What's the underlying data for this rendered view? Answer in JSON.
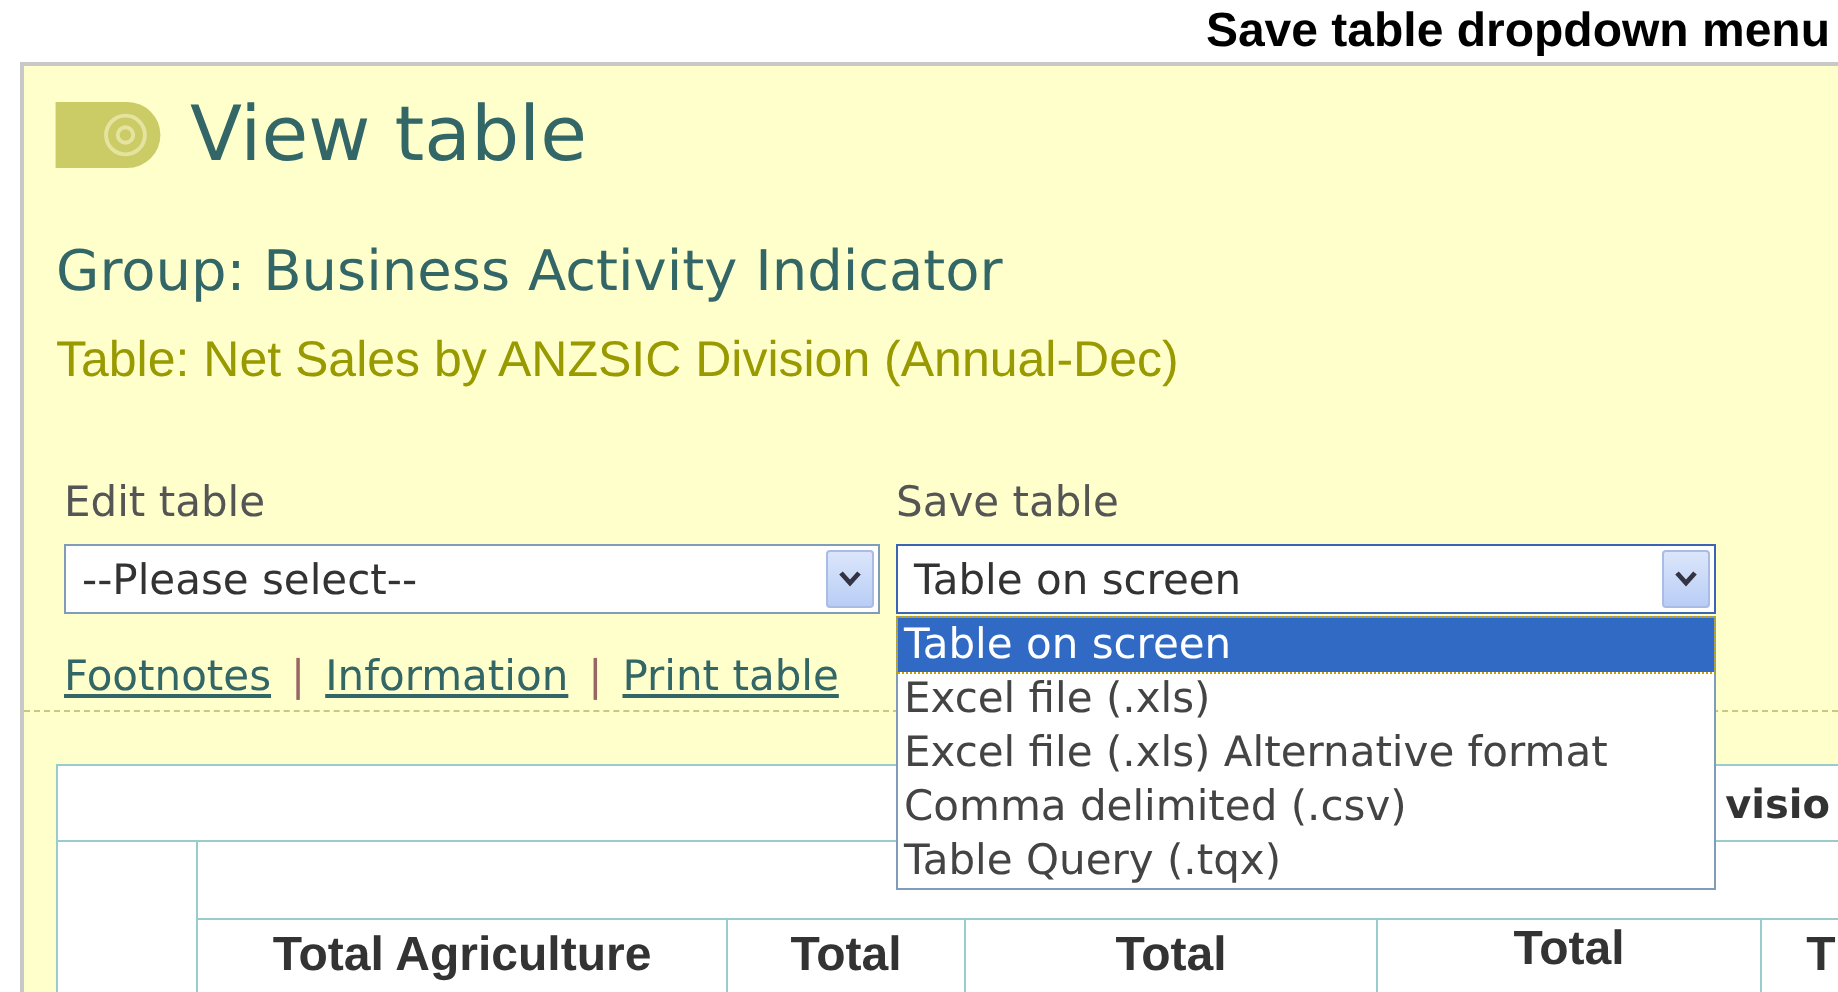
{
  "caption": "Save table dropdown menu",
  "page": {
    "title": "View table",
    "group": "Group: Business Activity Indicator",
    "table_name": "Table: Net Sales by ANZSIC Division (Annual-Dec)"
  },
  "edit_table": {
    "label": "Edit table",
    "value": "--Please select--"
  },
  "save_table": {
    "label": "Save table",
    "value": "Table on screen",
    "expanded": true,
    "options": [
      {
        "label": "Table on screen",
        "selected": true
      },
      {
        "label": "Excel file (.xls)",
        "selected": false
      },
      {
        "label": "Excel file (.xls) Alternative format",
        "selected": false
      },
      {
        "label": "Comma delimited (.csv)",
        "selected": false
      },
      {
        "label": "Table Query (.tqx)",
        "selected": false
      }
    ]
  },
  "links": [
    {
      "kind": "link",
      "text": "Footnotes"
    },
    {
      "kind": "separator",
      "text": "|"
    },
    {
      "kind": "link",
      "text": "Information"
    },
    {
      "kind": "separator",
      "text": "|"
    },
    {
      "kind": "link",
      "text": "Print table"
    }
  ],
  "table": {
    "title": "visio",
    "columns": [
      "Total Agriculture",
      "Total",
      "Total",
      "Total",
      "T"
    ]
  }
}
